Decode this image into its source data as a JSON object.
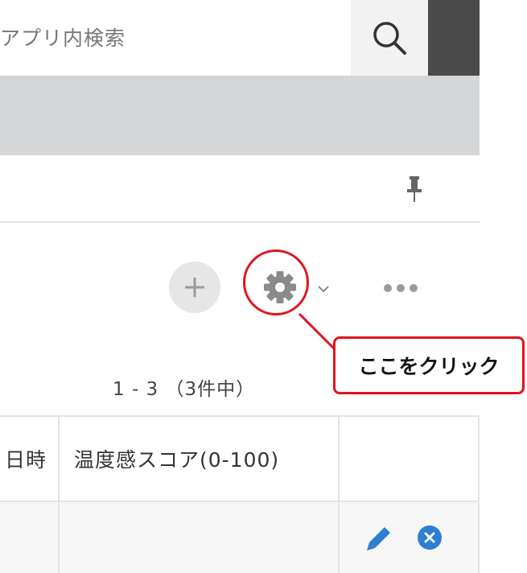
{
  "search": {
    "placeholder": "アプリ内検索",
    "button_icon": "search-icon"
  },
  "toolbar": {
    "pin_icon": "pin-icon",
    "add_icon": "plus-icon",
    "settings_icon": "gear-icon",
    "settings_dropdown_icon": "chevron-down-icon",
    "more_icon": "more-horizontal-icon"
  },
  "annotation": {
    "callout_text": "ここをクリック",
    "highlight_color": "#e0141e"
  },
  "pager": {
    "text": "1 - 3 （3件中）"
  },
  "table": {
    "headers": [
      "日時",
      "温度感スコア(0-100)",
      ""
    ],
    "rows": [
      {
        "cells": [
          "",
          "",
          ""
        ],
        "actions": [
          "pencil-icon",
          "close-circle-icon"
        ]
      }
    ]
  },
  "colors": {
    "band_gray": "#d4d6d8",
    "dark_block": "#4a4a4a",
    "action_blue": "#2d7fd3"
  }
}
